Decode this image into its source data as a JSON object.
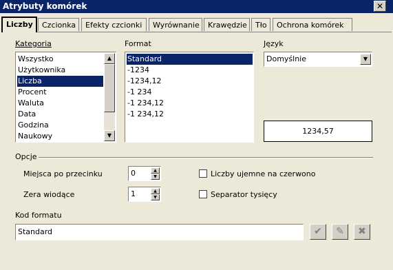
{
  "window": {
    "title": "Atrybuty komórek",
    "close_glyph": "✕"
  },
  "tabs": [
    {
      "label": "Liczby"
    },
    {
      "label": "Czcionka"
    },
    {
      "label": "Efekty czcionki"
    },
    {
      "label": "Wyrównanie"
    },
    {
      "label": "Krawędzie"
    },
    {
      "label": "Tło"
    },
    {
      "label": "Ochrona komórek"
    }
  ],
  "kategoria": {
    "label": "Kategoria",
    "items": [
      "Wszystko",
      "Użytkownika",
      "Liczba",
      "Procent",
      "Waluta",
      "Data",
      "Godzina",
      "Naukowy"
    ],
    "selected": "Liczba"
  },
  "format": {
    "label": "Format",
    "items": [
      "Standard",
      "-1234",
      "-1234,12",
      "-1 234",
      "-1 234,12",
      "-1 234,12"
    ],
    "selected": "Standard"
  },
  "jezyk": {
    "label": "Język",
    "value": "Domyślnie"
  },
  "preview": {
    "value": "1234,57"
  },
  "opcje": {
    "label": "Opcje",
    "miejsca_label": "Miejsca po przecinku",
    "miejsca_value": "0",
    "zera_label": "Zera wiodące",
    "zera_value": "1",
    "ujemne_label": "Liczby ujemne na czerwono",
    "ujemne_checked": false,
    "separator_label": "Separator tysięcy",
    "separator_checked": false
  },
  "kod": {
    "label": "Kod formatu",
    "value": "Standard"
  },
  "icons": {
    "scroll_up": "▲",
    "scroll_down": "▼",
    "dropdown": "▼",
    "spin_up": "▲",
    "spin_down": "▼",
    "apply": "✔",
    "comment": "✎",
    "delete": "✖"
  }
}
